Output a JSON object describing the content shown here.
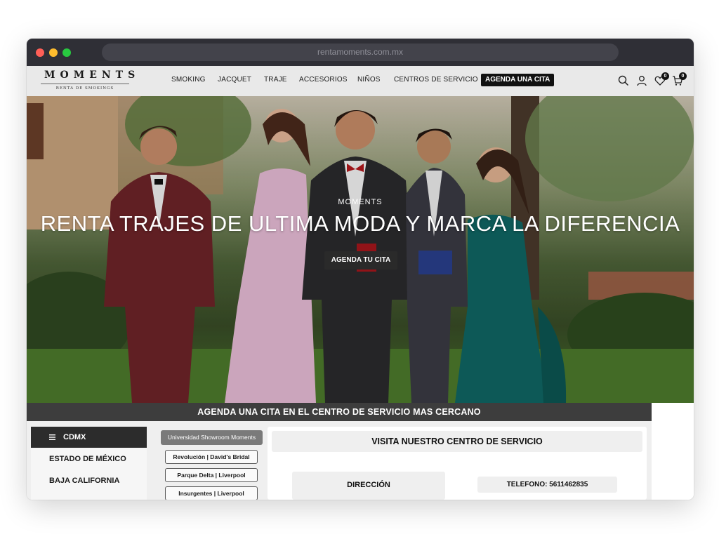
{
  "browser": {
    "url": "rentamoments.com.mx"
  },
  "header": {
    "logo_text": "MOMENTS",
    "logo_subtitle": "RENTA DE SMOKINGS",
    "nav": [
      "SMOKING",
      "JACQUET",
      "TRAJE",
      "ACCESORIOS",
      "NIÑOS",
      "CENTROS DE SERVICIO"
    ],
    "cta_label": "AGENDA UNA CITA",
    "wishlist_count": "0",
    "cart_count": "0",
    "icons": [
      "search-icon",
      "user-icon",
      "heart-icon",
      "cart-icon"
    ]
  },
  "hero": {
    "kicker": "MOMENTS",
    "title": "RENTA TRAJES DE ULTIMA MODA Y MARCA LA DIFERENCIA",
    "button_label": "AGENDA TU CITA"
  },
  "appointment": {
    "bar_title": "AGENDA UNA CITA EN EL CENTRO DE SERVICIO MAS CERCANO",
    "states": {
      "active": "CDMX",
      "items": [
        "ESTADO DE MÉXICO",
        "BAJA CALIFORNIA"
      ]
    },
    "branches": {
      "active": "Universidad Showroom Moments",
      "items": [
        "Revolución | David's Bridal",
        "Parque Delta | Liverpool",
        "Insurgentes | Liverpool"
      ]
    },
    "panel": {
      "title": "VISITA NUESTRO CENTRO DE SERVICIO",
      "address_label": "DIRECCIÓN",
      "phone": "TELEFONO: 5611462835"
    }
  },
  "colors": {
    "header_bg": "#e9e9e9",
    "dark": "#2c2c2c",
    "cta_bar": "#3d3d3d"
  }
}
